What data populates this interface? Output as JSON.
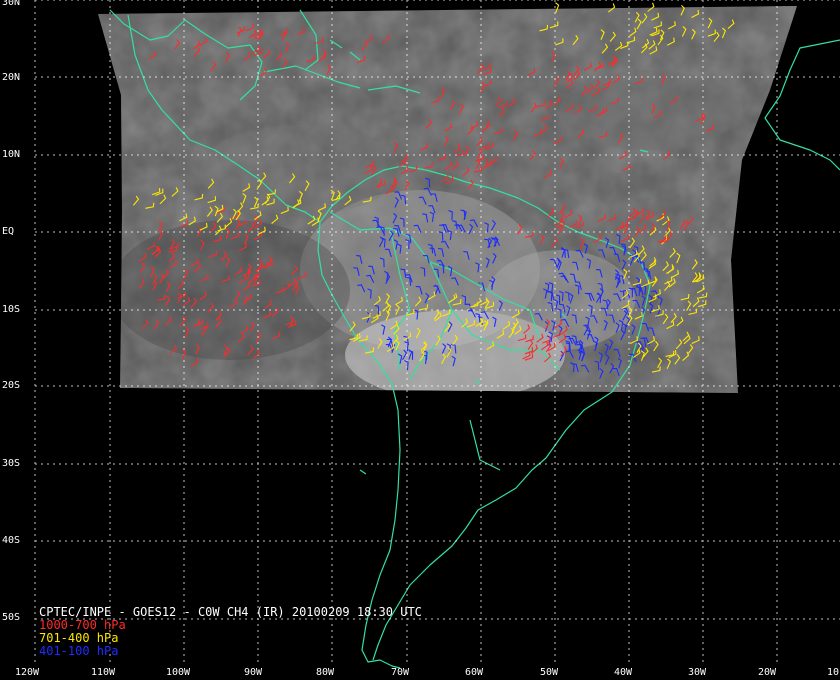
{
  "map": {
    "caption": "CPTEC/INPE - GOES12 - C0W CH4 (IR) 20100209 18:30 UTC",
    "latitude_labels": [
      "30N",
      "20N",
      "10N",
      "EQ",
      "10S",
      "20S",
      "30S",
      "40S",
      "50S"
    ],
    "longitude_labels": [
      "120W",
      "110W",
      "100W",
      "90W",
      "80W",
      "70W",
      "60W",
      "50W",
      "40W",
      "30W",
      "20W",
      "10"
    ],
    "legend": [
      {
        "label": "1000-700 hPa",
        "color": "#ff2a2a"
      },
      {
        "label": "701-400 hPa",
        "color": "#ffe800"
      },
      {
        "label": "401-100 hPa",
        "color": "#1e2cff"
      }
    ],
    "colors": {
      "background": "#000000",
      "grid": "#ffffff",
      "coastline": "#33e0a0",
      "satellite_gray": "#6a6a6a"
    },
    "icons": [
      "wind-barb-icon"
    ]
  }
}
